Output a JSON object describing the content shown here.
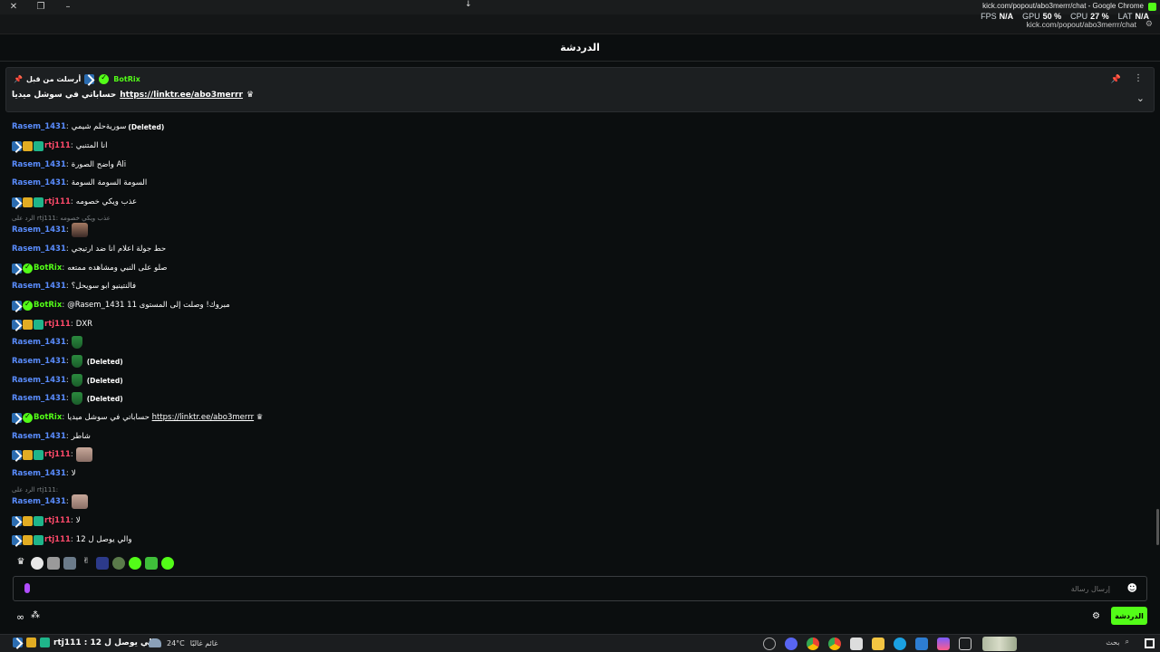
{
  "window": {
    "title": "kick.com/popout/abo3merrr/chat - Google Chrome",
    "url": "kick.com/popout/abo3merrr/chat"
  },
  "perf": {
    "fps_label": "FPS",
    "fps_value": "N/A",
    "gpu_label": "GPU",
    "gpu_value": "50 %",
    "cpu_label": "CPU",
    "cpu_value": "27 %",
    "lat_label": "LAT",
    "lat_value": "N/A"
  },
  "header": {
    "title": "الدردشة"
  },
  "pinned": {
    "pinned_by": "أرسلت من قبل",
    "user": "BotRix",
    "message": "حساباتي في سوشل ميديا",
    "link": "https://linktr.ee/abo3merrr"
  },
  "messages": [
    {
      "user": "Rasem_1431",
      "text": "سوريةحلم شيمي",
      "deleted": "(Deleted)"
    },
    {
      "user": "rtj111",
      "text": "انا المتنبي"
    },
    {
      "user": "Rasem_1431",
      "text": "واضح الصورة Ali"
    },
    {
      "user": "Rasem_1431",
      "text": "السومة السومة السومة"
    },
    {
      "user": "rtj111",
      "text": "عذب ويكي خصومه"
    },
    {
      "reply": "الرد على rtj111: عذب ويكي خصومه"
    },
    {
      "user": "Rasem_1431",
      "text": ""
    },
    {
      "user": "Rasem_1431",
      "text": "حط جولة اعلام انا ضد ارتيجي"
    },
    {
      "user": "BotRix",
      "text": "صلو على النبي ومشاهده ممتعه"
    },
    {
      "user": "Rasem_1431",
      "text": "فالنتينيو ابو سويحل؟"
    },
    {
      "user": "BotRix",
      "text": "@Rasem_1431 مبروك! وصلت إلى المستوى 11"
    },
    {
      "user": "rtj111",
      "text": "DXR"
    },
    {
      "user": "Rasem_1431",
      "text": ""
    },
    {
      "user": "Rasem_1431",
      "text": "",
      "deleted": "(Deleted)"
    },
    {
      "user": "Rasem_1431",
      "text": "",
      "deleted": "(Deleted)"
    },
    {
      "user": "Rasem_1431",
      "text": "",
      "deleted": "(Deleted)"
    },
    {
      "user": "BotRix",
      "text": "حساباتي في سوشل ميديا",
      "link": "https://linktr.ee/abo3merrr"
    },
    {
      "user": "Rasem_1431",
      "text": "شاطر"
    },
    {
      "user": "rtj111",
      "text": ""
    },
    {
      "user": "Rasem_1431",
      "text": "لا"
    },
    {
      "reply": "الرد على rtj111:"
    },
    {
      "user": "Rasem_1431",
      "text": ""
    },
    {
      "user": "rtj111",
      "text": "لا"
    },
    {
      "user": "rtj111",
      "text": "والي يوصل ل 12"
    }
  ],
  "input": {
    "placeholder": "إرسال رسالة"
  },
  "send_button": "الدردشة",
  "taskbar": {
    "notification": "rtj111 : والي يوصل ل 12",
    "temperature": "24°C",
    "weather_text": "غائم غالبًا",
    "search": "بحث"
  },
  "colors": {
    "accent": "#53fc18",
    "mod_user": "#5a8dff",
    "sub_user": "#ff4a6a"
  }
}
